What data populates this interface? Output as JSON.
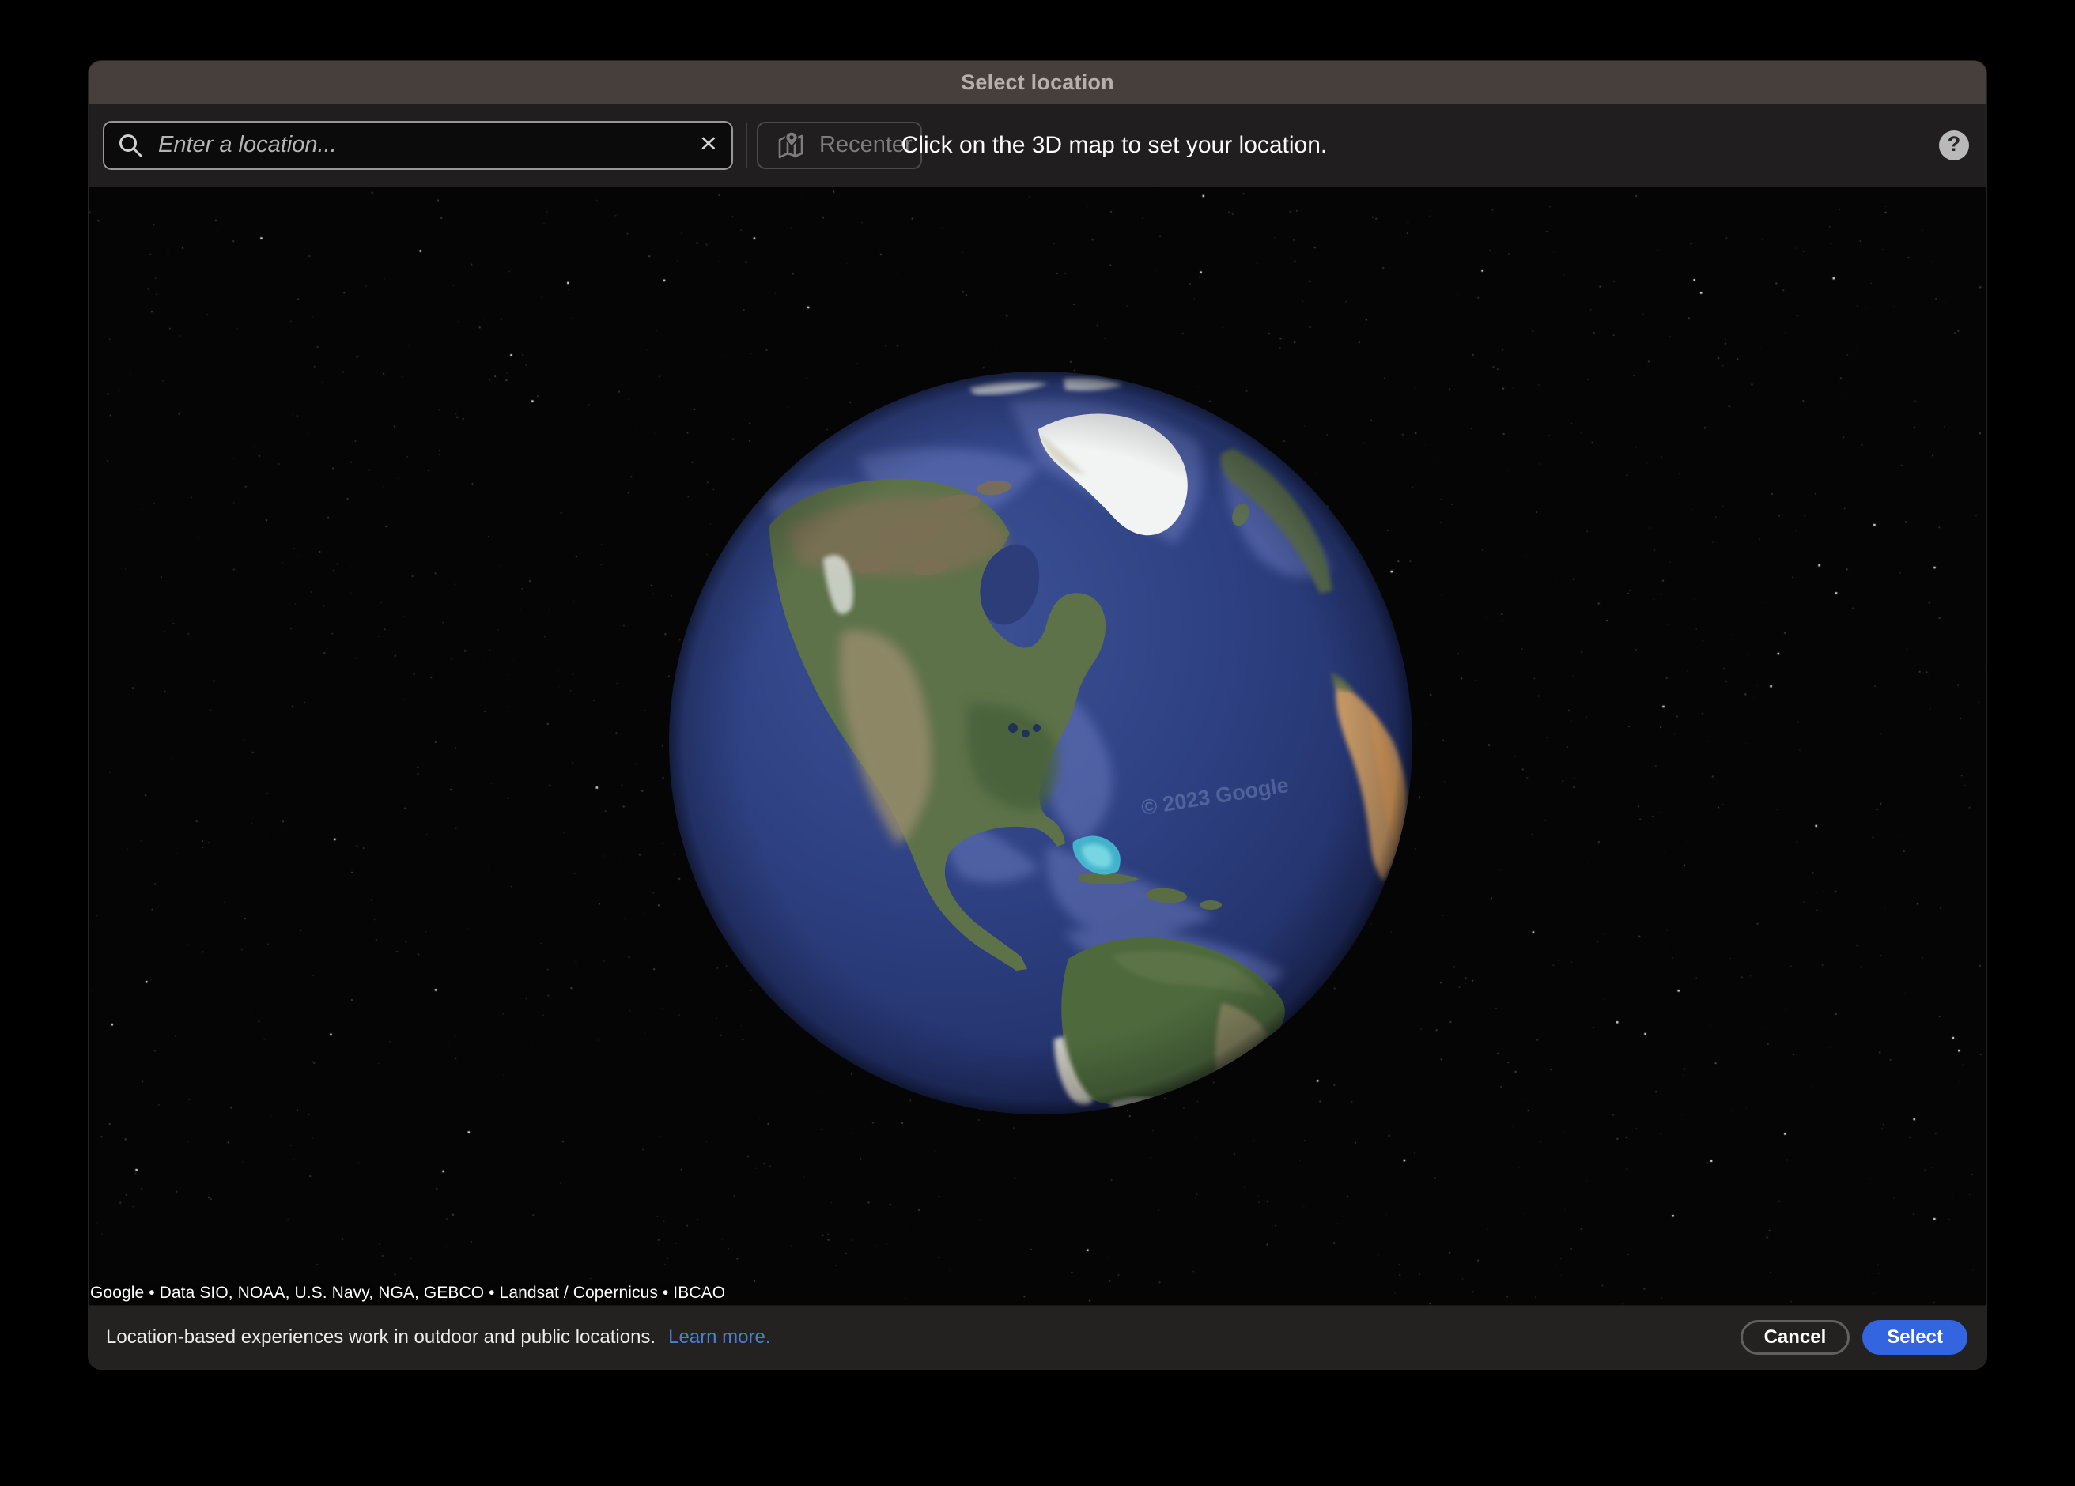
{
  "dialog": {
    "title": "Select location"
  },
  "toolbar": {
    "search": {
      "placeholder": "Enter a location...",
      "clear_icon": "×"
    },
    "recenter_label": "Recenter",
    "instruction": "Click on the 3D map to set your location.",
    "help_icon": "?"
  },
  "map": {
    "attribution": "Google • Data SIO, NOAA, U.S. Navy, NGA, GEBCO • Landsat / Copernicus • IBCAO",
    "watermark": "© 2023 Google"
  },
  "footer": {
    "note": "Location-based experiences work in outdoor and public locations.",
    "learn_more_label": "Learn more.",
    "cancel_label": "Cancel",
    "select_label": "Select"
  },
  "colors": {
    "accent_blue": "#3365e1",
    "link_blue": "#4a7fd9",
    "titlebar_brown": "#473f3b",
    "toolbar_bg": "#201e1e",
    "footer_bg": "#232221",
    "ocean_blue": "#2c3e7d"
  }
}
